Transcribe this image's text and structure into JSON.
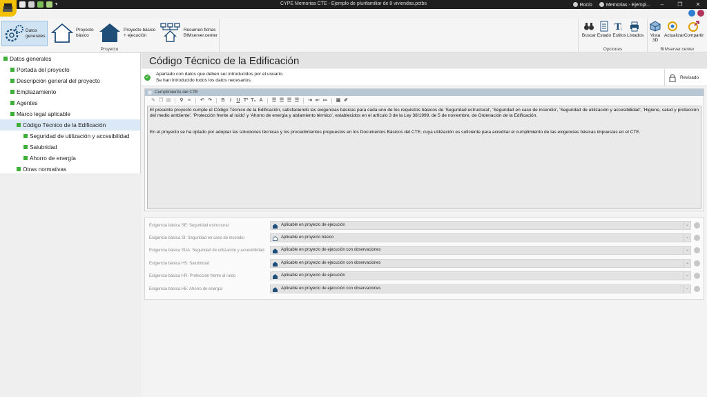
{
  "window": {
    "title": "CYPE Memorias CTE - Ejemplo de plurifamiliar de 8 viviendas.pctbs",
    "user": "Rocío",
    "doc_tab": "Memorias - Ejempl..."
  },
  "ribbon": {
    "proyecto": {
      "label": "Proyecto",
      "buttons": [
        {
          "label_1": "Datos",
          "label_2": "generales"
        },
        {
          "label_1": "Proyecto",
          "label_2": "básico"
        },
        {
          "label_1": "Proyecto básico",
          "label_2": "+ ejecución"
        },
        {
          "label_1": "Resumen fichas",
          "label_2": "BIMserver.center"
        }
      ]
    },
    "opciones": {
      "label": "Opciones",
      "buttons": [
        "Buscar",
        "Estado",
        "Estilos",
        "Listados"
      ]
    },
    "bimserver": {
      "label": "BIMserver.center",
      "buttons": [
        {
          "label_1": "Vista",
          "label_2": "3D"
        },
        {
          "label_1": "Actualizar",
          "label_2": ""
        },
        {
          "label_1": "Compartir",
          "label_2": ""
        }
      ]
    }
  },
  "sidebar": {
    "items": [
      {
        "label": "Datos generales"
      },
      {
        "label": "Portada del proyecto"
      },
      {
        "label": "Descripción general del proyecto"
      },
      {
        "label": "Emplazamiento"
      },
      {
        "label": "Agentes"
      },
      {
        "label": "Marco legal aplicable"
      },
      {
        "label": "Código Técnico de la Edificación"
      },
      {
        "label": "Seguridad de utilización y accesibilidad"
      },
      {
        "label": "Salubridad"
      },
      {
        "label": "Ahorro de energía"
      },
      {
        "label": "Otras normativas"
      }
    ]
  },
  "main": {
    "title": "Código Técnico de la Edificación",
    "info_line1": "Apartado con datos que deben ser introducidos por el usuario.",
    "info_line2": "Se han introducido todos los datos necesarios.",
    "revisado": "Revisado",
    "panel_title": "Cumplimiento del CTE",
    "paragraph1": "El presente proyecto cumple el Código Técnico de la Edificación, satisfaciendo las exigencias básicas para cada uno de los requisitos básicos de 'Seguridad estructural', 'Seguridad en caso de incendio', 'Seguridad de utilización y accesibilidad', 'Higiene, salud y protección del medio ambiente', 'Protección frente al ruido' y 'Ahorro de energía y aislamiento térmico', establecidos en el artículo 3 de la Ley 38/1999, de 5 de noviembre, de Ordenación de la Edificación.",
    "paragraph2": "En el proyecto se ha optado por adoptar las soluciones técnicas y los procedimientos propuestos en los Documentos Básicos del CTE, cuya utilización es suficiente para acreditar el cumplimiento de las exigencias básicas impuestas en el CTE."
  },
  "exigencias": [
    {
      "label": "Exigencia básica SE: Seguridad estructural",
      "value": "Aplicable en proyecto de ejecución",
      "icon": "house-solid-icon"
    },
    {
      "label": "Exigencia básica SI: Seguridad en caso de incendio",
      "value": "Aplicable en proyecto básico",
      "icon": "house-outline-icon"
    },
    {
      "label": "Exigencia básica SUA: Seguridad de utilización y accesibilidad",
      "value": "Aplicable en proyecto de ejecución con observaciones",
      "icon": "house-solid-icon"
    },
    {
      "label": "Exigencia básica HS: Salubridad",
      "value": "Aplicable en proyecto de ejecución con observaciones",
      "icon": "house-solid-icon"
    },
    {
      "label": "Exigencia básica HR: Protección frente al ruido",
      "value": "Aplicable en proyecto de ejecución",
      "icon": "house-solid-icon"
    },
    {
      "label": "Exigencia básica HE: Ahorro de energía",
      "value": "Aplicable en proyecto de ejecución con observaciones",
      "icon": "house-solid-icon"
    }
  ],
  "colors": {
    "accent": "#3fae3a",
    "house_blue": "#1f4e79",
    "logo_yellow": "#f3c000"
  }
}
